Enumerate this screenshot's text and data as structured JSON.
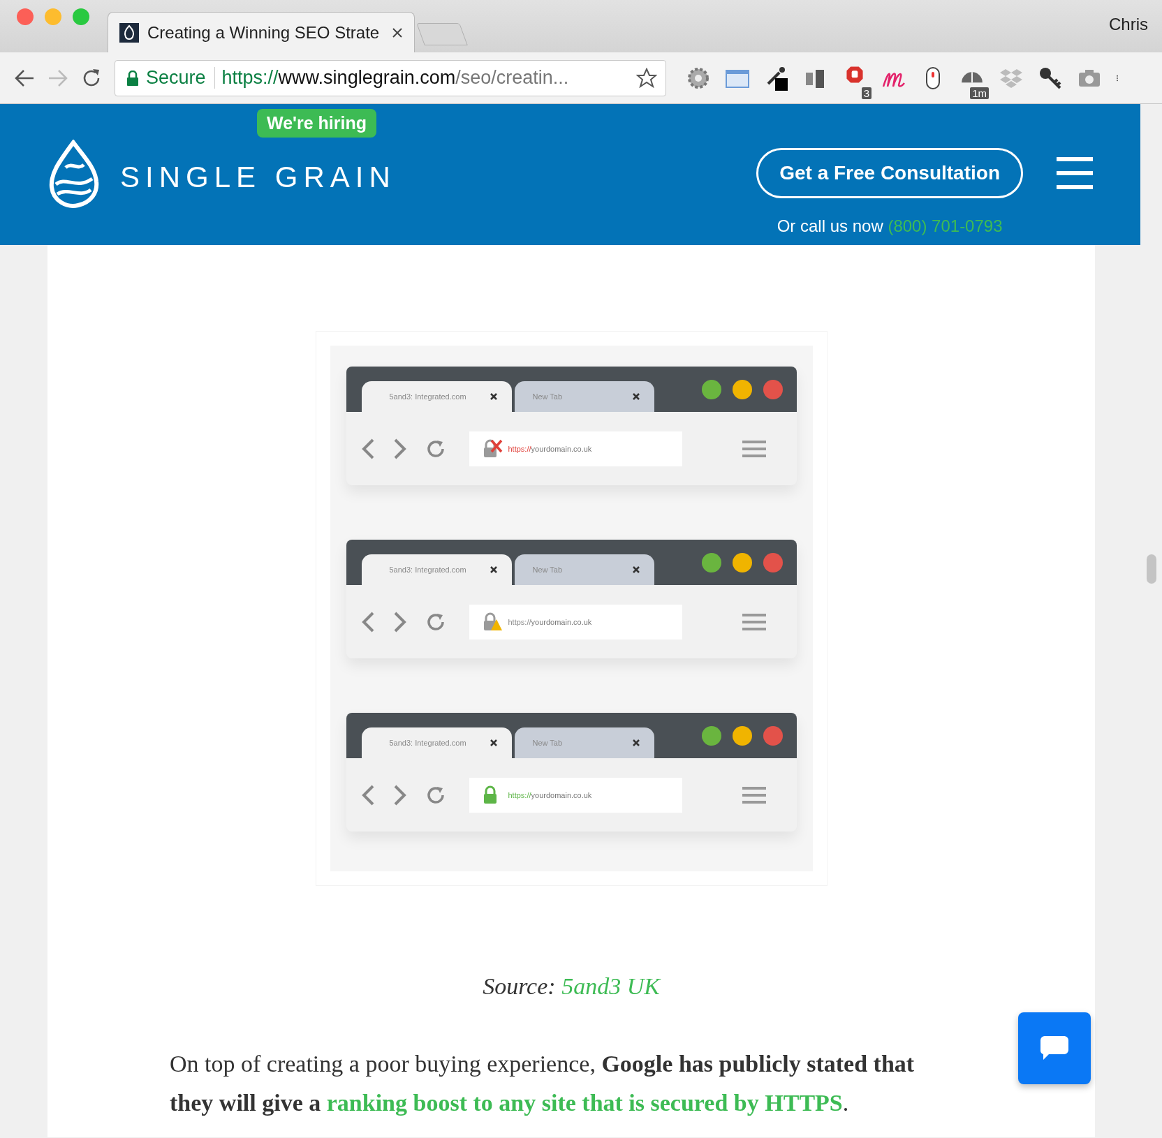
{
  "browser": {
    "tab_title": "Creating a Winning SEO Strate",
    "profile": "Chris",
    "secure_label": "Secure",
    "url_scheme": "https://",
    "url_host": "www.singlegrain.com",
    "url_path": "/seo/creatin...",
    "stop_badge": "3",
    "timer_badge": "1m"
  },
  "header": {
    "hiring": "We're hiring",
    "logo_text": "SINGLE GRAIN",
    "cta": "Get a Free Consultation",
    "call_prefix": "Or call us now",
    "phone": "(800) 701-0793"
  },
  "figure": {
    "mockups": [
      {
        "kind": "insecure",
        "tab": "5and3: Integrated.com",
        "new_tab": "New Tab",
        "scheme": "https://",
        "domain": "yourdomain.co.uk"
      },
      {
        "kind": "warning",
        "tab": "5and3: Integrated.com",
        "new_tab": "New Tab",
        "scheme": "https://",
        "domain": "yourdomain.co.uk"
      },
      {
        "kind": "secure",
        "tab": "5and3: Integrated.com",
        "new_tab": "New Tab",
        "scheme": "https://",
        "domain": "yourdomain.co.uk"
      }
    ]
  },
  "caption": {
    "label": "Source:",
    "link": "5and3 UK"
  },
  "paragraph": {
    "text": "On top of creating a poor buying experience, **Google has publicly stated that they will give a**",
    "link": "ranking boost to any site that is secured by HTTPS",
    "end": "."
  }
}
